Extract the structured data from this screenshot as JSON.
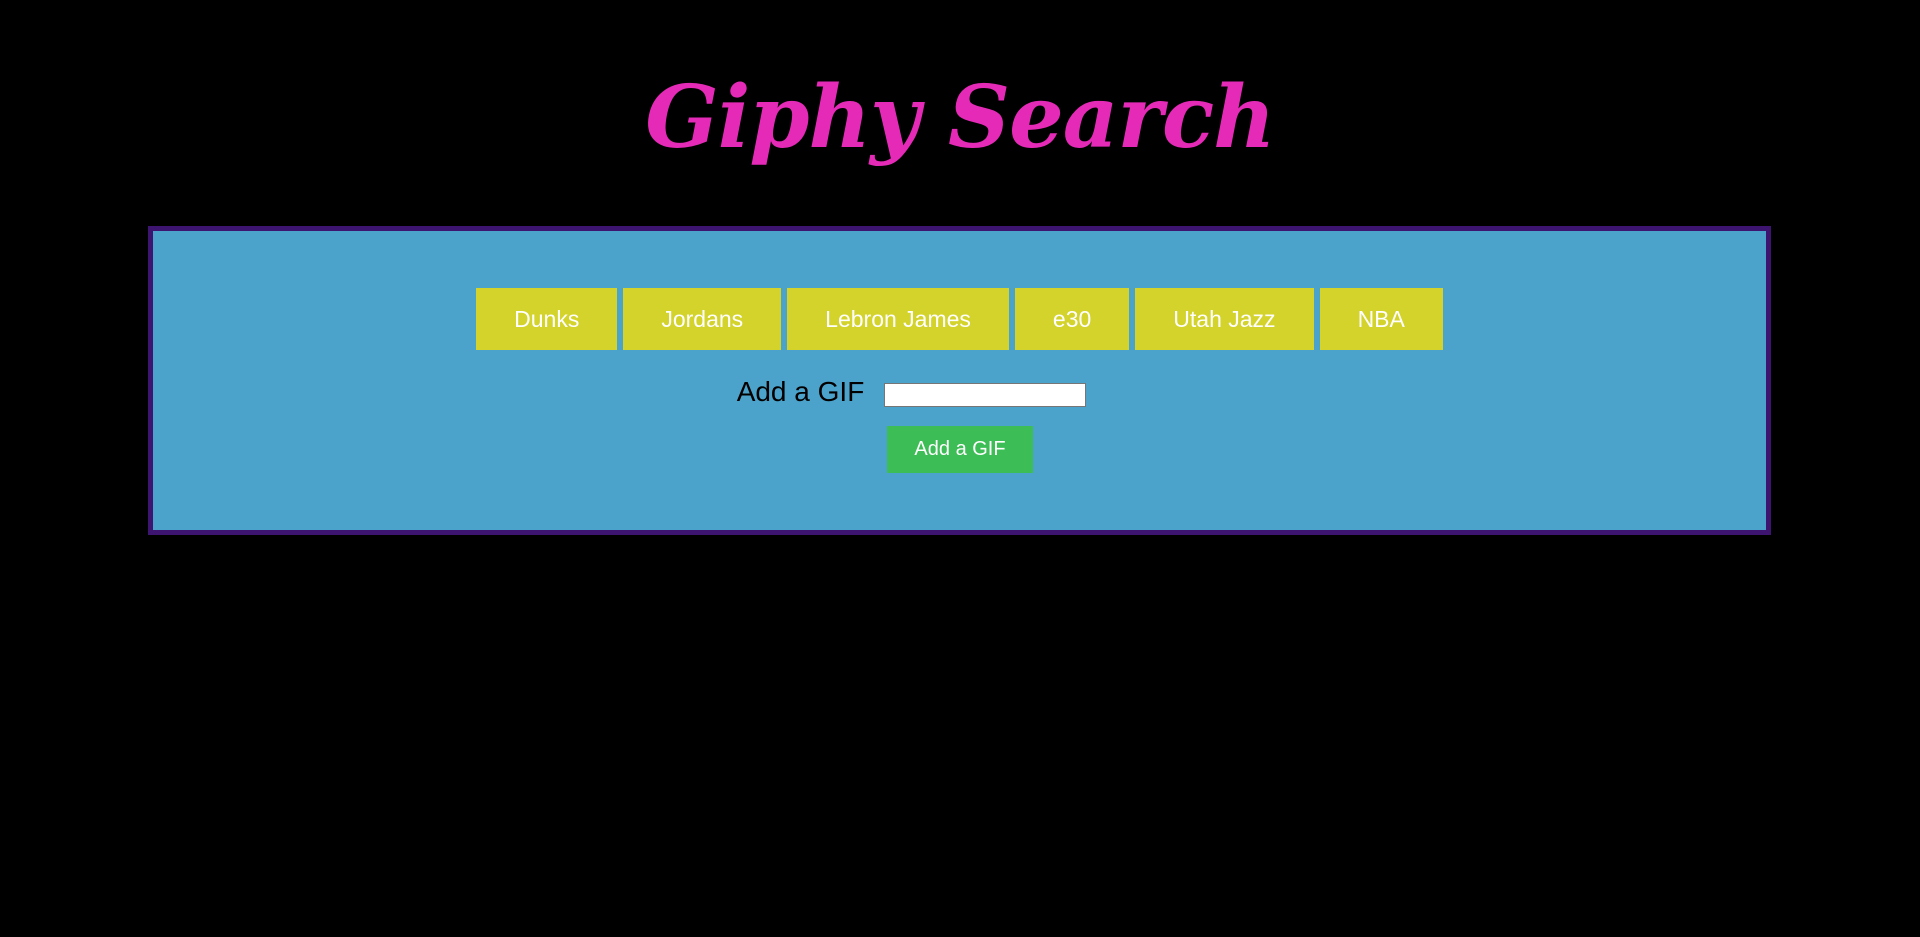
{
  "header": {
    "title": "Giphy Search"
  },
  "topics": {
    "buttons": [
      "Dunks",
      "Jordans",
      "Lebron James",
      "e30",
      "Utah Jazz",
      "NBA"
    ]
  },
  "form": {
    "label": "Add a GIF",
    "input_value": "",
    "input_placeholder": "",
    "submit_label": "Add a GIF"
  },
  "colors": {
    "background": "#000000",
    "title": "#e52ab8",
    "panel": "#4ba3cc",
    "panel_border": "#3d1470",
    "topic_button": "#d3d32b",
    "submit_button": "#3cbd55"
  }
}
